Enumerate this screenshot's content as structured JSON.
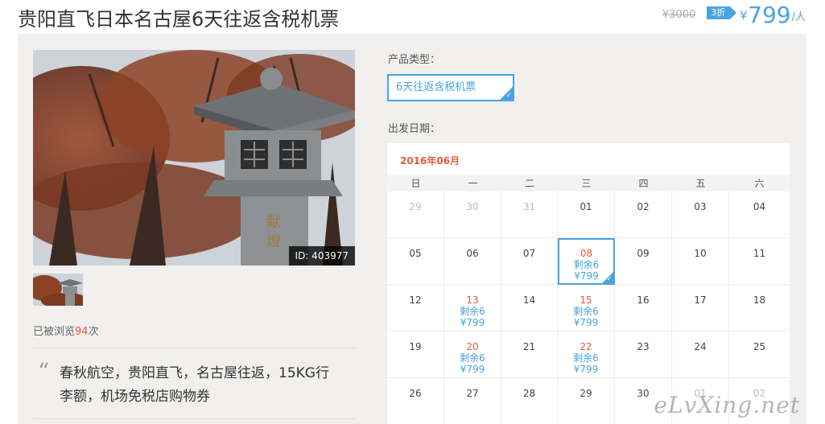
{
  "product": {
    "title": "贵阳直飞日本名古屋6天往返含税机票",
    "original_price": "¥3000",
    "discount": "3折",
    "currency": "¥",
    "price": "799",
    "per": "/人"
  },
  "gallery": {
    "image_id": "ID: 403977"
  },
  "views": {
    "prefix": "已被浏览",
    "count": "94",
    "suffix": "次"
  },
  "description": {
    "quote_mark": "“",
    "text": "春秋航空，贵阳直飞，名古屋往返，15KG行李额，机场免税店购物券"
  },
  "options": {
    "type_label": "产品类型：",
    "type_value": "6天往返含税机票",
    "date_label": "出发日期："
  },
  "calendar": {
    "month": "2016年06月",
    "weekdays": [
      "日",
      "一",
      "二",
      "三",
      "四",
      "五",
      "六"
    ],
    "weeks": [
      [
        {
          "d": "29",
          "m": true
        },
        {
          "d": "30",
          "m": true
        },
        {
          "d": "31",
          "m": true
        },
        {
          "d": "01"
        },
        {
          "d": "02"
        },
        {
          "d": "03"
        },
        {
          "d": "04"
        }
      ],
      [
        {
          "d": "05"
        },
        {
          "d": "06"
        },
        {
          "d": "07"
        },
        {
          "d": "08",
          "s1": "剩余6",
          "s2": "¥799",
          "sel": true
        },
        {
          "d": "09"
        },
        {
          "d": "10"
        },
        {
          "d": "11"
        }
      ],
      [
        {
          "d": "12"
        },
        {
          "d": "13",
          "s1": "剩余6",
          "s2": "¥799"
        },
        {
          "d": "14"
        },
        {
          "d": "15",
          "s1": "剩余6",
          "s2": "¥799"
        },
        {
          "d": "16"
        },
        {
          "d": "17"
        },
        {
          "d": "18"
        }
      ],
      [
        {
          "d": "19"
        },
        {
          "d": "20",
          "s1": "剩余6",
          "s2": "¥799"
        },
        {
          "d": "21"
        },
        {
          "d": "22",
          "s1": "剩余6",
          "s2": "¥799"
        },
        {
          "d": "23"
        },
        {
          "d": "24"
        },
        {
          "d": "25"
        }
      ],
      [
        {
          "d": "26"
        },
        {
          "d": "27"
        },
        {
          "d": "28"
        },
        {
          "d": "29"
        },
        {
          "d": "30"
        },
        {
          "d": "01",
          "m": true
        },
        {
          "d": "02",
          "m": true
        }
      ]
    ]
  },
  "watermark": "eLvXing.net",
  "colors": {
    "accent": "#4aa3df",
    "highlight": "#e55a3b"
  }
}
